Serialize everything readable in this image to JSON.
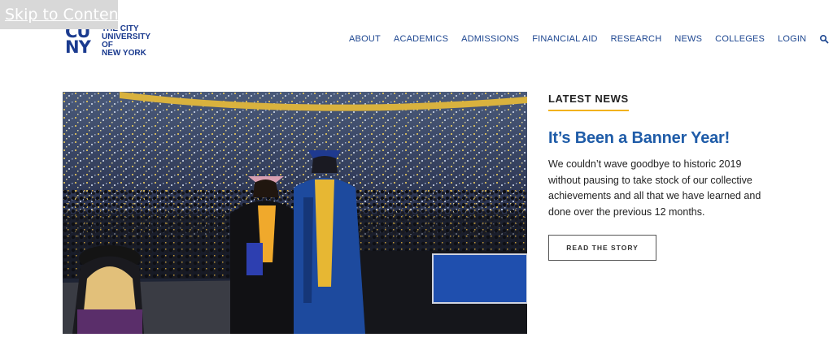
{
  "skip_link": "Skip to Content",
  "logo": {
    "mark_top": "CU",
    "mark_bottom": "NY",
    "lines": [
      "THE CITY",
      "UNIVERSITY",
      "OF",
      "NEW YORK"
    ],
    "color": "#1b3b8f"
  },
  "nav": {
    "items": [
      "ABOUT",
      "ACADEMICS",
      "ADMISSIONS",
      "FINANCIAL AID",
      "RESEARCH",
      "NEWS",
      "COLLEGES",
      "LOGIN"
    ],
    "search_icon": "search-icon",
    "color": "#1d4690"
  },
  "news": {
    "section_label": "LATEST NEWS",
    "headline": "It’s Been a Banner Year!",
    "body": "We couldn’t wave goodbye to historic 2019 without pausing to take stock of our collective achievements and all that we have learned and done over the previous 12 months.",
    "button": "READ THE STORY",
    "accent": "#f2b21c",
    "headline_color": "#1f5ca8"
  }
}
